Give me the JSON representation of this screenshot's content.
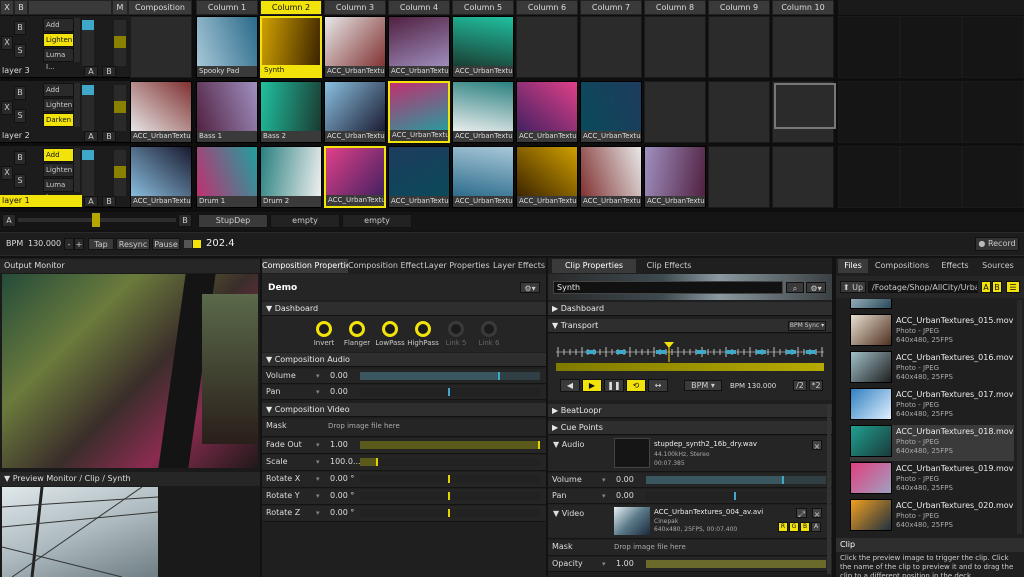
{
  "deck": {
    "top_labels": {
      "x": "X",
      "b": "B",
      "m": "M",
      "s": "S",
      "a": "A"
    },
    "composition_label": "Composition",
    "columns": [
      "Column 1",
      "Column 2",
      "Column 3",
      "Column 4",
      "Column 5",
      "Column 6",
      "Column 7",
      "Column 8",
      "Column 9",
      "Column 10"
    ],
    "selected_column": 1,
    "layers": [
      {
        "name": "layer 3",
        "blends": [
          "Add",
          "Lighten",
          "Luma I..."
        ],
        "clips": [
          "Spooky Pad",
          "Synth",
          "ACC_UrbanTextures",
          "ACC_UrbanTextures",
          "ACC_UrbanTextures"
        ]
      },
      {
        "name": "layer 2",
        "blends": [
          "Add",
          "Lighten",
          "Darken"
        ],
        "clips": [
          "ACC_UrbanTextures",
          "Bass 1",
          "Bass 2",
          "ACC_UrbanTextures",
          "ACC_UrbanTextures",
          "ACC_UrbanTextures",
          "ACC_UrbanTextures",
          "ACC_UrbanTextures"
        ]
      },
      {
        "name": "layer 1",
        "blends": [
          "Add",
          "Lighten",
          "Luma I..."
        ],
        "clips": [
          "ACC_UrbanTextures",
          "Drum 1",
          "Drum 2",
          "ACC_UrbanTextures",
          "ACC_UrbanTextures",
          "ACC_UrbanTextures",
          "ACC_UrbanTextures",
          "ACC_UrbanTextures",
          "ACC_UrbanTextures"
        ]
      }
    ],
    "crossfader": {
      "a": "A",
      "b": "B"
    },
    "deck_tabs": [
      "StupDep",
      "empty",
      "empty"
    ]
  },
  "transport_bar": {
    "bpm_label": "BPM",
    "bpm_value": "130.000",
    "minus": "-",
    "plus": "+",
    "tap": "Tap",
    "resync": "Resync",
    "pause": "Pause",
    "bpm_display": "202.4",
    "record": "Record"
  },
  "output_monitor": {
    "title": "Output Monitor"
  },
  "preview_monitor": {
    "title": "Preview Monitor / Clip / Synth"
  },
  "composition": {
    "tabs": [
      "Composition Properties",
      "Composition Effects",
      "Layer Properties",
      "Layer Effects"
    ],
    "name": "Demo",
    "dashboard_title": "Dashboard",
    "knobs": [
      {
        "label": "Invert",
        "active": true
      },
      {
        "label": "Flanger",
        "active": true
      },
      {
        "label": "LowPass",
        "active": true
      },
      {
        "label": "HighPass",
        "active": true
      },
      {
        "label": "Link 5",
        "active": false
      },
      {
        "label": "Link 6",
        "active": false
      }
    ],
    "audio_title": "Composition Audio",
    "audio_rows": [
      {
        "name": "Volume",
        "value": "0.00"
      },
      {
        "name": "Pan",
        "value": "0.00"
      }
    ],
    "video_title": "Composition Video",
    "mask": {
      "name": "Mask",
      "hint": "Drop image file here"
    },
    "video_rows": [
      {
        "name": "Fade Out",
        "value": "1.00"
      },
      {
        "name": "Scale",
        "value": "100.0..."
      },
      {
        "name": "Rotate X",
        "value": "0.00 °"
      },
      {
        "name": "Rotate Y",
        "value": "0.00 °"
      },
      {
        "name": "Rotate Z",
        "value": "0.00 °"
      }
    ]
  },
  "clip": {
    "tabs": [
      "Clip Properties",
      "Clip Effects"
    ],
    "name": "Synth",
    "dashboard_title": "Dashboard",
    "transport_title": "Transport",
    "bpm_sync": "BPM Sync",
    "bpm_mode": "BPM",
    "bpm_value": "BPM 130.000",
    "half": "/2",
    "double": "*2",
    "beatloopr": "BeatLoopr",
    "cue_points": "Cue Points",
    "audio_label": "Audio",
    "audio_file": "stupdep_synth2_16b_dry.wav",
    "audio_info": "44.100kHz, Stereo",
    "audio_time": "00:07.385",
    "volume": {
      "name": "Volume",
      "value": "0.00"
    },
    "pan": {
      "name": "Pan",
      "value": "0.00"
    },
    "video_label": "Video",
    "video_file": "ACC_UrbanTextures_004_av.avi",
    "video_codec": "Cinepak",
    "video_info": "640x480, 25FPS, 00:07.400",
    "rgba": [
      "R",
      "G",
      "B",
      "A"
    ],
    "mask": {
      "name": "Mask",
      "hint": "Drop image file here"
    },
    "opacity": {
      "name": "Opacity",
      "value": "1.00"
    }
  },
  "browser": {
    "tabs": [
      "Files",
      "Compositions",
      "Effects",
      "Sources"
    ],
    "up": "Up",
    "path": "/Footage/Shop/AllCity/Urba...",
    "a": "A",
    "b": "B",
    "files": [
      {
        "name": "",
        "type": "Photo - JPEG",
        "info": "640x480, 25FPS"
      },
      {
        "name": "ACC_UrbanTextures_015.mov",
        "type": "Photo - JPEG",
        "info": "640x480, 25FPS"
      },
      {
        "name": "ACC_UrbanTextures_016.mov",
        "type": "Photo - JPEG",
        "info": "640x480, 25FPS"
      },
      {
        "name": "ACC_UrbanTextures_017.mov",
        "type": "Photo - JPEG",
        "info": "640x480, 25FPS"
      },
      {
        "name": "ACC_UrbanTextures_018.mov",
        "type": "Photo - JPEG",
        "info": "640x480, 25FPS"
      },
      {
        "name": "ACC_UrbanTextures_019.mov",
        "type": "Photo - JPEG",
        "info": "640x480, 25FPS"
      },
      {
        "name": "ACC_UrbanTextures_020.mov",
        "type": "Photo - JPEG",
        "info": "640x480, 25FPS"
      }
    ],
    "selected_file": 4
  },
  "help": {
    "title": "Clip",
    "text": "Click the preview image to trigger the clip. Click the name of the clip to preview it and to drag the clip to a different position in the deck."
  },
  "colors": {
    "accent": "#f2e30a",
    "cyan": "#3fa8c8",
    "panel": "#252525"
  }
}
